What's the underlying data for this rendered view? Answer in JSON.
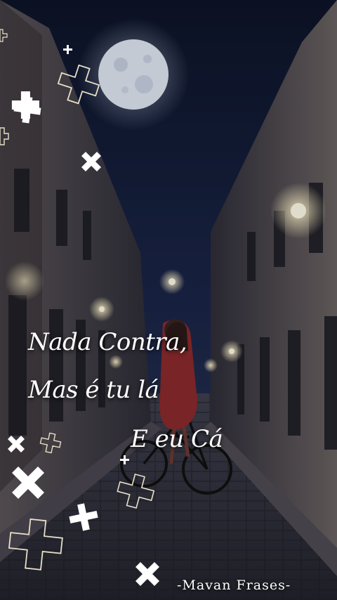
{
  "quote": {
    "line1": "Nada Contra,",
    "line2": "Mas é tu lá",
    "line3": "E eu Cá"
  },
  "signature": "-Mavan Frases-",
  "colors": {
    "sky": "#16213f",
    "moon": "#dfe6f2",
    "text": "#ffffff",
    "street": "#3b3a48",
    "lamp": "#fff6d8"
  },
  "icons": [
    "moon-icon",
    "plus-icon",
    "x-icon",
    "bicycle-icon"
  ]
}
